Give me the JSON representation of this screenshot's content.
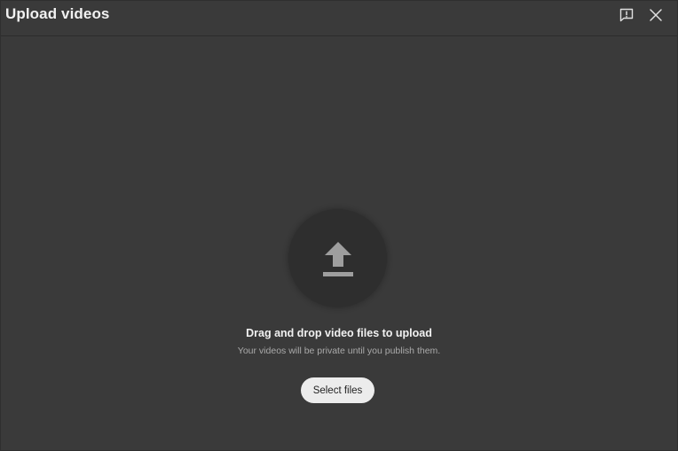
{
  "dialog": {
    "title": "Upload videos",
    "feedback_icon": "feedback-icon",
    "close_icon": "close-icon"
  },
  "dropzone": {
    "icon": "upload-icon",
    "headline": "Drag and drop video files to upload",
    "subtext": "Your videos will be private until you publish them.",
    "select_label": "Select files"
  },
  "colors": {
    "background": "#3a3a3a",
    "circle": "#2e2e2e",
    "icon": "#9e9e9e",
    "button": "#ececec"
  }
}
